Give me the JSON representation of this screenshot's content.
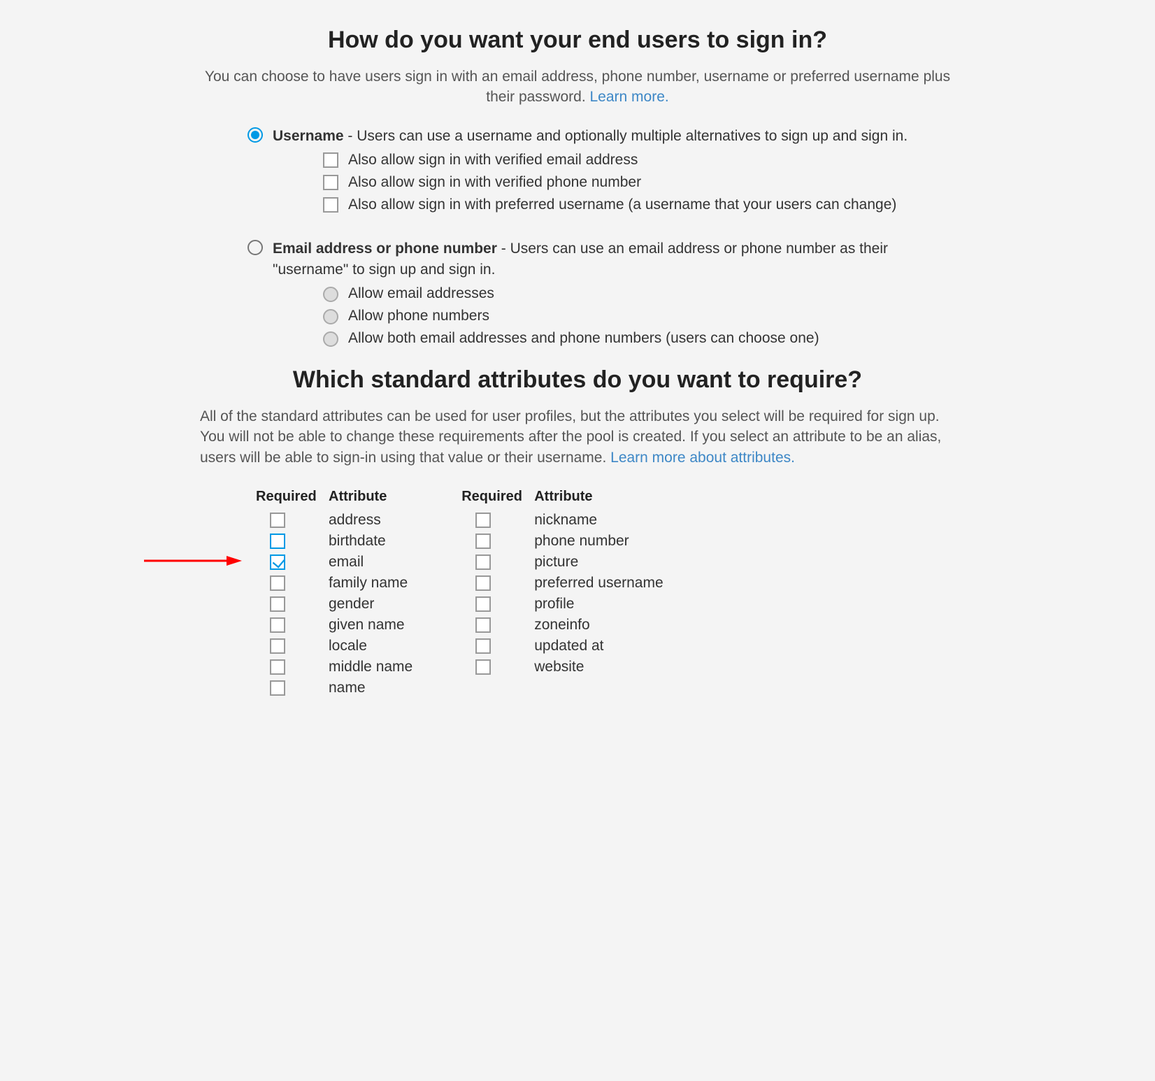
{
  "section1": {
    "heading": "How do you want your end users to sign in?",
    "intro": "You can choose to have users sign in with an email address, phone number, username or preferred username plus their password. ",
    "learn_more": "Learn more.",
    "option_username": {
      "label": "Username",
      "desc": " - Users can use a username and optionally multiple alternatives to sign up and sign in.",
      "sub": {
        "email": "Also allow sign in with verified email address",
        "phone": "Also allow sign in with verified phone number",
        "preferred": "Also allow sign in with preferred username (a username that your users can change)"
      }
    },
    "option_emailphone": {
      "label": "Email address or phone number",
      "desc": " - Users can use an email address or phone number as their \"username\" to sign up and sign in.",
      "sub": {
        "email": "Allow email addresses",
        "phone": "Allow phone numbers",
        "both": "Allow both email addresses and phone numbers (users can choose one)"
      }
    }
  },
  "section2": {
    "heading": "Which standard attributes do you want to require?",
    "intro": "All of the standard attributes can be used for user profiles, but the attributes you select will be required for sign up. You will not be able to change these requirements after the pool is created. If you select an attribute to be an alias, users will be able to sign-in using that value or their username. ",
    "learn_more": "Learn more about attributes.",
    "header_required": "Required",
    "header_attribute": "Attribute",
    "col1": {
      "0": "address",
      "1": "birthdate",
      "2": "email",
      "3": "family name",
      "4": "gender",
      "5": "given name",
      "6": "locale",
      "7": "middle name",
      "8": "name"
    },
    "col2": {
      "0": "nickname",
      "1": "phone number",
      "2": "picture",
      "3": "preferred username",
      "4": "profile",
      "5": "zoneinfo",
      "6": "updated at",
      "7": "website"
    }
  }
}
